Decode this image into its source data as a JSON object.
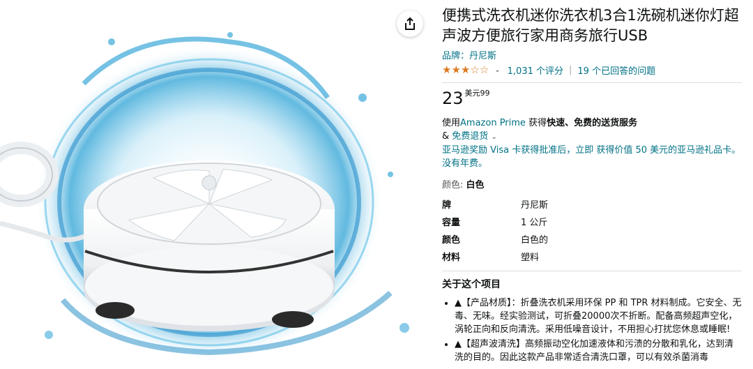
{
  "product": {
    "title": "便携式洗衣机迷你洗衣机3合1洗碗机迷你灯超声波方便旅行家用商务旅行USB",
    "brand_label": "品牌：丹尼斯",
    "rating_value": 3,
    "ratings_count": "1,031 个评分",
    "answered_questions": "19 个已回答的问题",
    "price_whole": "23",
    "price_fraction": "美元99"
  },
  "shipping": {
    "prime_prefix": "使用",
    "prime_link": "Amazon Prime",
    "prime_mid": " 获得",
    "prime_bold": "快速、免费的送货服务",
    "returns_prefix": "& ",
    "returns_link": "免费退货",
    "visa_offer": "亚马逊奖励 Visa 卡获得批准后，立即 获得价值 50 美元的亚马逊礼品卡。没有年费。"
  },
  "color": {
    "label": "颜色: ",
    "value": "白色"
  },
  "specs": [
    {
      "key": "牌",
      "value": "丹尼斯"
    },
    {
      "key": "容量",
      "value": "1 公斤"
    },
    {
      "key": "颜色",
      "value": "白色的"
    },
    {
      "key": "材料",
      "value": "塑料"
    }
  ],
  "about": {
    "title": "关于这个项目",
    "bullets": [
      "▲【产品材质】：折叠洗衣机采用环保 PP 和 TPR 材料制成。它安全、无毒、无味。经实验测试，可折叠20000次不折断。配备高频超声空化，涡轮正向和反向清洗。采用低噪音设计，不用担心打扰您休息或睡眠!",
      "▲【超声波清洗】高频振动空化加速液体和污渍的分散和乳化，达到清洗的目的。因此这款产品非常适合清洗口罩，可以有效杀菌消毒"
    ]
  },
  "icons": {
    "share": "share-icon",
    "star_full": "star-full-icon",
    "star_empty": "star-empty-icon",
    "chevron": "chevron-down-icon"
  },
  "colors": {
    "link": "#007185",
    "star": "#de7921",
    "water": "#3aa8d8"
  }
}
